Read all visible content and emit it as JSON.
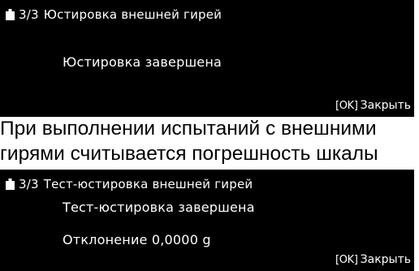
{
  "screen_completion": {
    "step": "3/3",
    "title": "Юстировка внешней гирей",
    "message": "Юстировка завершена",
    "ok_key": "[OK]",
    "close_label": "Закрыть"
  },
  "description": {
    "line1": "При выполнении испытаний с внешними",
    "line2": "гирями считывается погрешность шкалы"
  },
  "screen_test": {
    "step": "3/3",
    "title": "Тест-юстировка внешней гирей",
    "message": "Тест-юстировка завершена",
    "deviation": "Отклонение 0,0000 g",
    "ok_key": "[OK]",
    "close_label": "Закрыть"
  },
  "icons": {
    "header_icon": "weight-icon"
  },
  "colors": {
    "screen_bg": "#000000",
    "screen_text": "#ffffff",
    "page_bg": "#ffffff",
    "caption_text": "#000000"
  }
}
